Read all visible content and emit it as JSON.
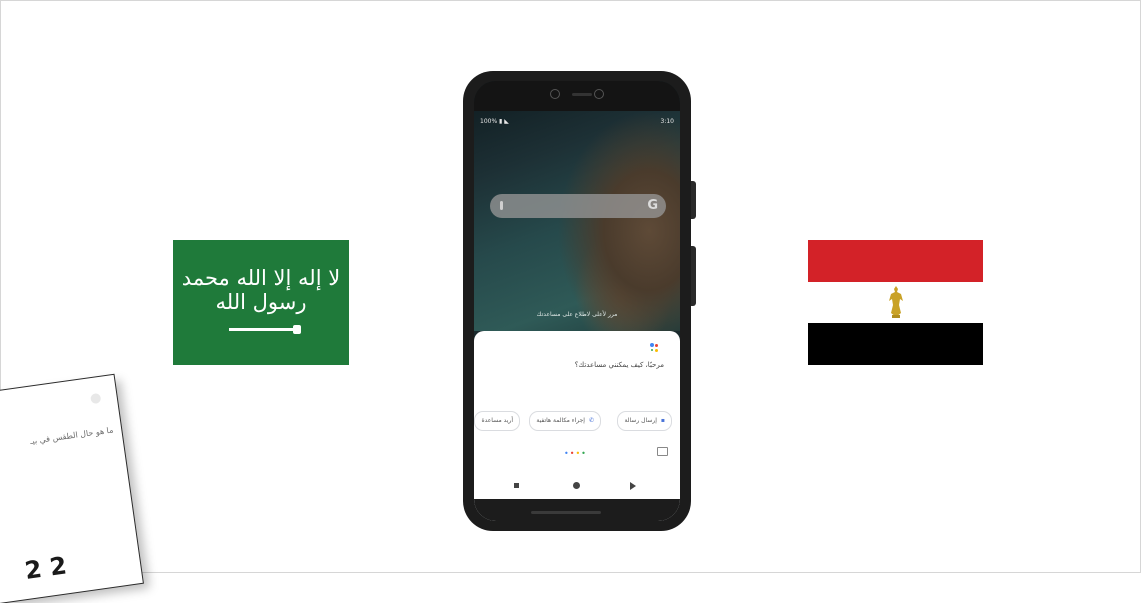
{
  "flags": {
    "saudi": {
      "shahada_text": "لا إله إلا الله محمد رسول الله",
      "colors": {
        "field": "#1f7a3a",
        "emblem": "#ffffff"
      }
    },
    "egypt": {
      "colors": {
        "red": "#d32228",
        "white": "#ffffff",
        "black": "#000000",
        "eagle": "#c9a227"
      }
    }
  },
  "phone": {
    "status_bar": {
      "left": "100% ▮ ◣",
      "time": "3:10"
    },
    "search_bar": {
      "logo": "G"
    },
    "swipe_hint": "مرر لأعلى لاطلاع على مساعدتك",
    "assistant": {
      "greeting": "مرحبًا، كيف يمكنني مساعدتك؟",
      "chips": [
        {
          "label": "إرسال رسالة",
          "icon": "message-icon"
        },
        {
          "label": "إجراء مكالمة هاتفية",
          "icon": "phone-icon"
        },
        {
          "label": "أريد مساعدة",
          "icon": ""
        }
      ],
      "colors": {
        "blue": "#4285f4",
        "red": "#ea4335",
        "yellow": "#fbbc05",
        "green": "#34a853"
      }
    }
  },
  "paper_card": {
    "question": "ما هو حال الطقس في بيـ",
    "big_text": "2 2"
  }
}
